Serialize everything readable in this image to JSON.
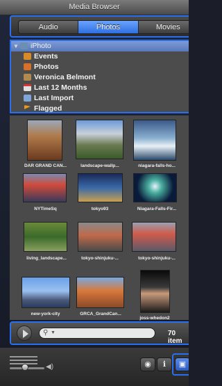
{
  "window": {
    "title": "Media Browser"
  },
  "tabs": [
    {
      "label": "Audio",
      "active": false
    },
    {
      "label": "Photos",
      "active": true
    },
    {
      "label": "Movies",
      "active": false
    }
  ],
  "sources": [
    {
      "label": "iPhoto",
      "icon": "iphoto-icon",
      "selected": true
    },
    {
      "label": "Events",
      "icon": "events-icon",
      "selected": false
    },
    {
      "label": "Photos",
      "icon": "photos-icon",
      "selected": false
    },
    {
      "label": "Veronica Belmont",
      "icon": "album-icon",
      "selected": false
    },
    {
      "label": "Last 12 Months",
      "icon": "calendar-icon",
      "selected": false
    },
    {
      "label": "Last Import",
      "icon": "import-icon",
      "selected": false
    },
    {
      "label": "Flagged",
      "icon": "flag-icon",
      "selected": false
    }
  ],
  "thumbnails": [
    {
      "caption": "DAR GRAND CAN..."
    },
    {
      "caption": "landscape-wallp..."
    },
    {
      "caption": "niagara-falls-ho..."
    },
    {
      "caption": "NYTimeSq"
    },
    {
      "caption": "tokyo93"
    },
    {
      "caption": "Niagara-Falls-Fir..."
    },
    {
      "caption": "living_landscape..."
    },
    {
      "caption": "tokyo-shinjuku-..."
    },
    {
      "caption": "tokyo-shinjuku-..."
    },
    {
      "caption": "new-york-city"
    },
    {
      "caption": "GRCA_GrandCan..."
    },
    {
      "caption": "joss-whedon2"
    }
  ],
  "bottom": {
    "count_label": "70 item"
  },
  "colors": {
    "accent": "#2a6ff0"
  }
}
